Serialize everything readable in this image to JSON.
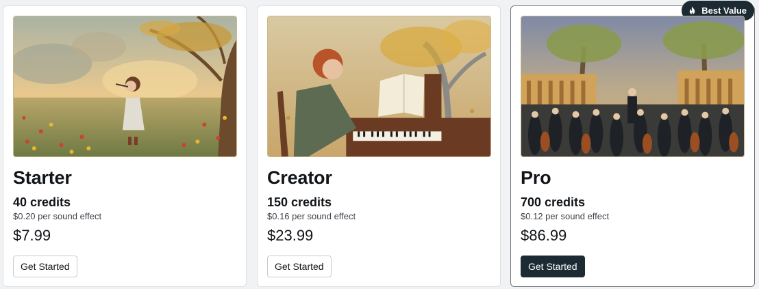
{
  "plans": [
    {
      "name": "Starter",
      "credits": "40 credits",
      "per_effect": "$0.20 per sound effect",
      "price": "$7.99",
      "button": "Get Started",
      "image_icon": "girl-playing-flute-in-meadow-painting"
    },
    {
      "name": "Creator",
      "credits": "150 credits",
      "per_effect": "$0.16 per sound effect",
      "price": "$23.99",
      "button": "Get Started",
      "image_icon": "boy-playing-piano-painting"
    },
    {
      "name": "Pro",
      "credits": "700 credits",
      "per_effect": "$0.12 per sound effect",
      "price": "$86.99",
      "button": "Get Started",
      "badge": "Best Value",
      "badge_icon": "flame-icon",
      "image_icon": "orchestra-concert-painting"
    }
  ],
  "colors": {
    "primary_button": "#1c2b33",
    "badge_background": "#1c2b33",
    "highlight_border": "#6f7378"
  }
}
